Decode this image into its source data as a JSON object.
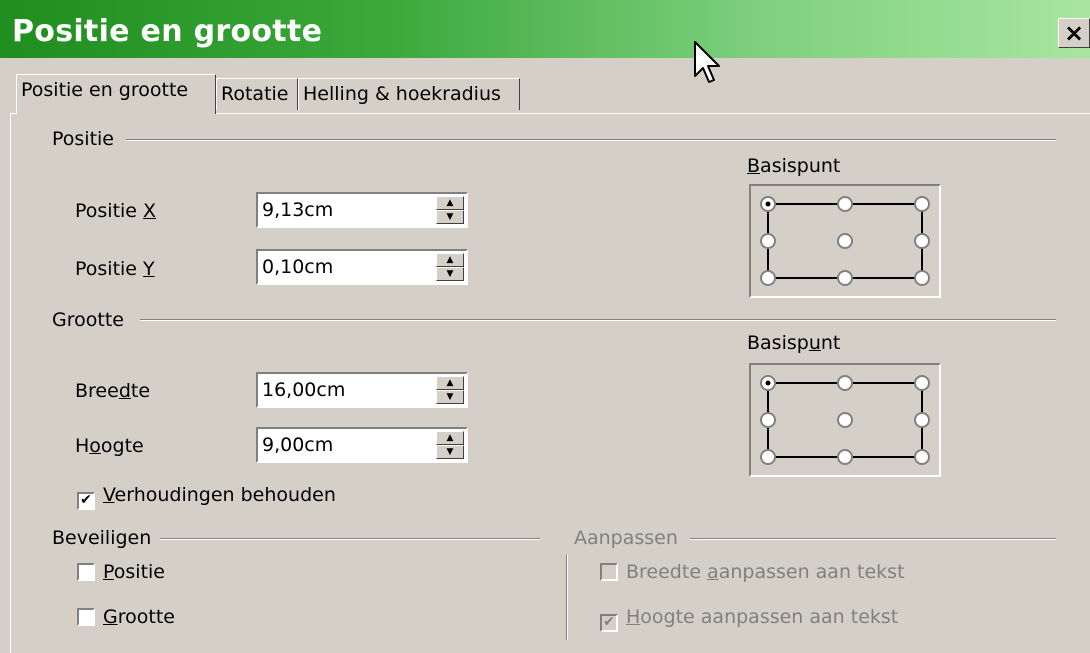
{
  "window": {
    "title": "Positie en grootte",
    "close_label": "×"
  },
  "tabs": [
    {
      "label": "Positie en grootte",
      "active": true
    },
    {
      "label": "Rotatie",
      "active": false
    },
    {
      "label": "Helling & hoekradius",
      "active": false
    }
  ],
  "position": {
    "group_label": "Positie",
    "x_label_pre": "Positie ",
    "x_label_key": "X",
    "x_value": "9,13cm",
    "y_label_pre": "Positie ",
    "y_label_key": "Y",
    "y_value": "0,10cm",
    "basis_label_key": "B",
    "basis_label_rest": "asispunt"
  },
  "size": {
    "group_label": "Grootte",
    "width_label_pre": "Bree",
    "width_label_key": "d",
    "width_label_post": "te",
    "width_value": "16,00cm",
    "height_label_pre": "H",
    "height_label_key": "o",
    "height_label_post": "ogte",
    "height_value": "9,00cm",
    "basis_label_pre": "Basisp",
    "basis_label_key": "u",
    "basis_label_post": "nt",
    "keep_ratio_key": "V",
    "keep_ratio_rest": "erhoudingen behouden",
    "keep_ratio_checked": true
  },
  "protect": {
    "group_label": "Beveiligen",
    "position_key": "P",
    "position_rest": "ositie",
    "position_checked": false,
    "size_key": "G",
    "size_rest": "rootte",
    "size_checked": false
  },
  "adjust": {
    "group_label": "Aanpassen",
    "fit_width_pre": "Breedte ",
    "fit_width_key": "a",
    "fit_width_post": "anpassen aan tekst",
    "fit_width_checked": false,
    "fit_height_key": "H",
    "fit_height_rest": "oogte aanpassen aan tekst",
    "fit_height_checked": true
  },
  "checkmark": "✔",
  "icons": {
    "close": "close-icon",
    "cursor": "mouse-pointer-icon",
    "spin_up": "▲",
    "spin_down": "▼"
  },
  "colors": {
    "titlebar_start": "#1f8e1f",
    "titlebar_end": "#a8e6a0",
    "face": "#d4d0c8"
  }
}
